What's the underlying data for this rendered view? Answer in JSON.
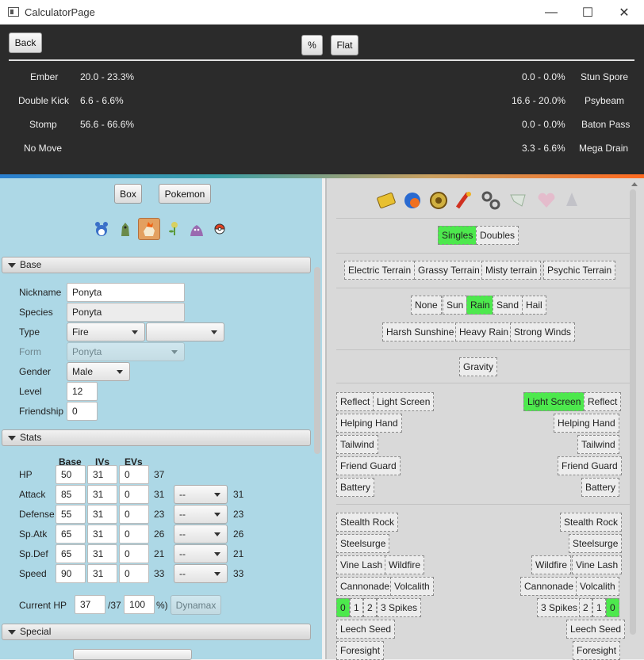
{
  "window": {
    "title": "CalculatorPage",
    "min": "—",
    "max": "☐",
    "close": "✕"
  },
  "top": {
    "back": "Back",
    "percent": "%",
    "flat": "Flat",
    "my_moves": [
      {
        "name": "Ember",
        "dmg": "20.0 - 23.3%"
      },
      {
        "name": "Double Kick",
        "dmg": "6.6 - 6.6%"
      },
      {
        "name": "Stomp",
        "dmg": "56.6 - 66.6%"
      },
      {
        "name": "No Move",
        "dmg": ""
      }
    ],
    "opp_moves": [
      {
        "name": "Stun Spore",
        "dmg": "0.0 - 0.0%"
      },
      {
        "name": "Psybeam",
        "dmg": "16.6 - 20.0%"
      },
      {
        "name": "Baton Pass",
        "dmg": "0.0 - 0.0%"
      },
      {
        "name": "Mega Drain",
        "dmg": "3.3 - 6.6%"
      }
    ]
  },
  "left": {
    "box": "Box",
    "pokemon": "Pokemon",
    "party_icons": [
      "marill-icon",
      "larvitar-icon",
      "ponyta-icon",
      "bellsprout-icon",
      "grimer-icon",
      "pokeball-icon"
    ],
    "sections": {
      "base": "Base",
      "stats": "Stats",
      "special": "Special"
    },
    "form": {
      "nickname_label": "Nickname",
      "nickname": "Ponyta",
      "species_label": "Species",
      "species": "Ponyta",
      "type_label": "Type",
      "type1": "Fire",
      "type2": "",
      "form_label": "Form",
      "form": "Ponyta",
      "gender_label": "Gender",
      "gender": "Male",
      "level_label": "Level",
      "level": "12",
      "friendship_label": "Friendship",
      "friendship": "0"
    },
    "stats_headers": {
      "base": "Base",
      "ivs": "IVs",
      "evs": "EVs"
    },
    "stats": [
      {
        "name": "HP",
        "base": "50",
        "iv": "31",
        "ev": "0",
        "val": "37",
        "nature": "",
        "final": ""
      },
      {
        "name": "Attack",
        "base": "85",
        "iv": "31",
        "ev": "0",
        "val": "31",
        "nature": "--",
        "final": "31"
      },
      {
        "name": "Defense",
        "base": "55",
        "iv": "31",
        "ev": "0",
        "val": "23",
        "nature": "--",
        "final": "23"
      },
      {
        "name": "Sp.Atk",
        "base": "65",
        "iv": "31",
        "ev": "0",
        "val": "26",
        "nature": "--",
        "final": "26"
      },
      {
        "name": "Sp.Def",
        "base": "65",
        "iv": "31",
        "ev": "0",
        "val": "21",
        "nature": "--",
        "final": "21"
      },
      {
        "name": "Speed",
        "base": "90",
        "iv": "31",
        "ev": "0",
        "val": "33",
        "nature": "--",
        "final": "33"
      }
    ],
    "current_hp_label": "Current HP",
    "current_hp": "37",
    "max_hp": "/37",
    "hp_pct": "100",
    "pct_close": "%)",
    "dynamax": "Dynamax"
  },
  "right": {
    "item_icons": [
      "badge-icon",
      "ball-icon",
      "bell-icon",
      "hook-icon",
      "link-icon",
      "scarf-icon",
      "heart-icon",
      "drop-icon"
    ],
    "format": {
      "singles": "Singles",
      "doubles": "Doubles"
    },
    "terrains": [
      "Electric Terrain",
      "Grassy Terrain",
      "Misty terrain",
      "Psychic Terrain"
    ],
    "weather1": [
      "None",
      "Sun",
      "Rain",
      "Sand",
      "Hail"
    ],
    "weather2": [
      "Harsh Sunshine",
      "Heavy Rain",
      "Strong Winds"
    ],
    "gravity": "Gravity",
    "reflect": "Reflect",
    "light_screen": "Light Screen",
    "helping_hand": "Helping Hand",
    "tailwind": "Tailwind",
    "friend_guard": "Friend Guard",
    "battery": "Battery",
    "stealth_rock": "Stealth Rock",
    "steelsurge": "Steelsurge",
    "vine_lash": "Vine Lash",
    "wildfire": "Wildfire",
    "cannonade": "Cannonade",
    "volcalith": "Volcalith",
    "spikes": [
      "0",
      "1",
      "2",
      "3 Spikes"
    ],
    "leech_seed": "Leech Seed",
    "foresight": "Foresight"
  },
  "colors": {
    "active": "#4de84d",
    "panel_left": "#add8e6",
    "panel_right": "#d9d9d9",
    "dark": "#2b2b2b"
  }
}
